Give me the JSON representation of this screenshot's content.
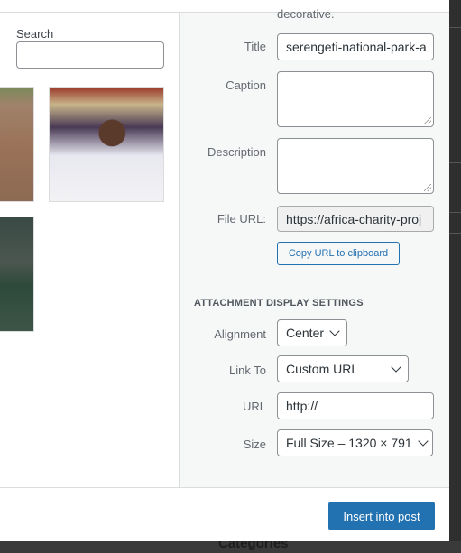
{
  "background": {
    "partial_heading": "Categories"
  },
  "left": {
    "search_label": "Search",
    "search_value": ""
  },
  "details": {
    "alt_help_tail": "decorative.",
    "title_label": "Title",
    "title_value": "serengeti-national-park-a",
    "caption_label": "Caption",
    "caption_value": "",
    "description_label": "Description",
    "description_value": "",
    "file_url_label": "File URL:",
    "file_url_value": "https://africa-charity-proj",
    "copy_button": "Copy URL to clipboard"
  },
  "display_settings": {
    "heading": "ATTACHMENT DISPLAY SETTINGS",
    "alignment_label": "Alignment",
    "alignment_value": "Center",
    "link_to_label": "Link To",
    "link_to_value": "Custom URL",
    "url_label": "URL",
    "url_value": "http://",
    "size_label": "Size",
    "size_value": "Full Size – 1320 × 791"
  },
  "footer": {
    "insert_button": "Insert into post"
  },
  "colors": {
    "primary": "#2271b1",
    "sidebar_bg": "#f6f7f7"
  }
}
